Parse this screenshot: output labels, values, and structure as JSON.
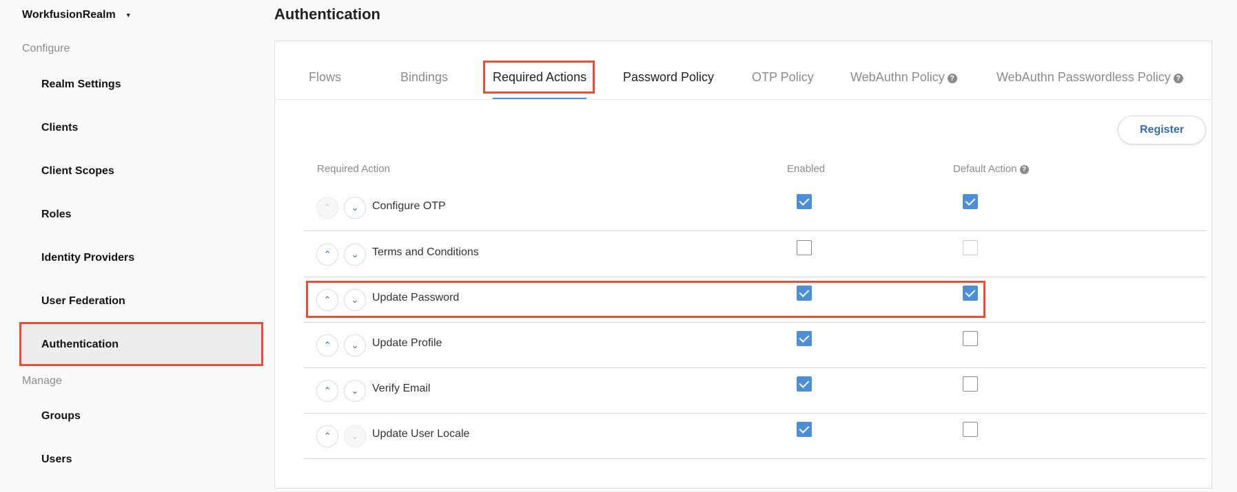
{
  "sidebar": {
    "realm_name": "WorkfusionRealm",
    "configure_label": "Configure",
    "manage_label": "Manage",
    "configure_items": [
      {
        "label": "Realm Settings"
      },
      {
        "label": "Clients"
      },
      {
        "label": "Client Scopes"
      },
      {
        "label": "Roles"
      },
      {
        "label": "Identity Providers"
      },
      {
        "label": "User Federation"
      },
      {
        "label": "Authentication",
        "active": true
      }
    ],
    "manage_items": [
      {
        "label": "Groups"
      },
      {
        "label": "Users"
      }
    ]
  },
  "page": {
    "title": "Authentication"
  },
  "tabs": [
    {
      "label": "Flows"
    },
    {
      "label": "Bindings"
    },
    {
      "label": "Required Actions",
      "active": true
    },
    {
      "label": "Password Policy"
    },
    {
      "label": "OTP Policy"
    },
    {
      "label": "WebAuthn Policy",
      "help_icon": "question-circle-icon"
    },
    {
      "label": "WebAuthn Passwordless Policy",
      "help_icon": "question-circle-icon"
    }
  ],
  "register_button": "Register",
  "table": {
    "headers": {
      "required_action": "Required Action",
      "enabled": "Enabled",
      "default_action": "Default Action"
    },
    "rows": [
      {
        "label": "Configure OTP",
        "enabled": true,
        "default_action": true,
        "up_disabled": true,
        "down_disabled": false
      },
      {
        "label": "Terms and Conditions",
        "enabled": false,
        "default_action": false,
        "default_disabled": true,
        "up_disabled": false,
        "down_disabled": false
      },
      {
        "label": "Update Password",
        "enabled": true,
        "default_action": true,
        "up_disabled": false,
        "down_disabled": false
      },
      {
        "label": "Update Profile",
        "enabled": true,
        "default_action": false,
        "up_disabled": false,
        "down_disabled": false
      },
      {
        "label": "Verify Email",
        "enabled": true,
        "default_action": false,
        "up_disabled": false,
        "down_disabled": false
      },
      {
        "label": "Update User Locale",
        "enabled": true,
        "default_action": false,
        "up_disabled": false,
        "down_disabled": true
      }
    ]
  },
  "colors": {
    "accent": "#4d8fd6",
    "link": "#3b6cb0",
    "highlight": "#ea4e32"
  }
}
